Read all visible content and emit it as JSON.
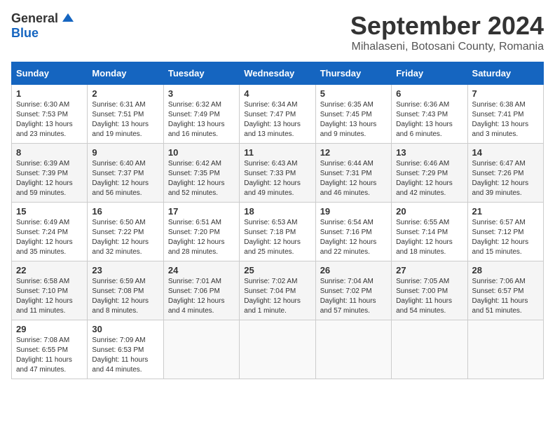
{
  "logo": {
    "general": "General",
    "blue": "Blue"
  },
  "header": {
    "month": "September 2024",
    "location": "Mihalaseni, Botosani County, Romania"
  },
  "days_of_week": [
    "Sunday",
    "Monday",
    "Tuesday",
    "Wednesday",
    "Thursday",
    "Friday",
    "Saturday"
  ],
  "weeks": [
    [
      {
        "day": "1",
        "sunrise": "6:30 AM",
        "sunset": "7:53 PM",
        "daylight": "13 hours and 23 minutes."
      },
      {
        "day": "2",
        "sunrise": "6:31 AM",
        "sunset": "7:51 PM",
        "daylight": "13 hours and 19 minutes."
      },
      {
        "day": "3",
        "sunrise": "6:32 AM",
        "sunset": "7:49 PM",
        "daylight": "13 hours and 16 minutes."
      },
      {
        "day": "4",
        "sunrise": "6:34 AM",
        "sunset": "7:47 PM",
        "daylight": "13 hours and 13 minutes."
      },
      {
        "day": "5",
        "sunrise": "6:35 AM",
        "sunset": "7:45 PM",
        "daylight": "13 hours and 9 minutes."
      },
      {
        "day": "6",
        "sunrise": "6:36 AM",
        "sunset": "7:43 PM",
        "daylight": "13 hours and 6 minutes."
      },
      {
        "day": "7",
        "sunrise": "6:38 AM",
        "sunset": "7:41 PM",
        "daylight": "13 hours and 3 minutes."
      }
    ],
    [
      {
        "day": "8",
        "sunrise": "6:39 AM",
        "sunset": "7:39 PM",
        "daylight": "12 hours and 59 minutes."
      },
      {
        "day": "9",
        "sunrise": "6:40 AM",
        "sunset": "7:37 PM",
        "daylight": "12 hours and 56 minutes."
      },
      {
        "day": "10",
        "sunrise": "6:42 AM",
        "sunset": "7:35 PM",
        "daylight": "12 hours and 52 minutes."
      },
      {
        "day": "11",
        "sunrise": "6:43 AM",
        "sunset": "7:33 PM",
        "daylight": "12 hours and 49 minutes."
      },
      {
        "day": "12",
        "sunrise": "6:44 AM",
        "sunset": "7:31 PM",
        "daylight": "12 hours and 46 minutes."
      },
      {
        "day": "13",
        "sunrise": "6:46 AM",
        "sunset": "7:29 PM",
        "daylight": "12 hours and 42 minutes."
      },
      {
        "day": "14",
        "sunrise": "6:47 AM",
        "sunset": "7:26 PM",
        "daylight": "12 hours and 39 minutes."
      }
    ],
    [
      {
        "day": "15",
        "sunrise": "6:49 AM",
        "sunset": "7:24 PM",
        "daylight": "12 hours and 35 minutes."
      },
      {
        "day": "16",
        "sunrise": "6:50 AM",
        "sunset": "7:22 PM",
        "daylight": "12 hours and 32 minutes."
      },
      {
        "day": "17",
        "sunrise": "6:51 AM",
        "sunset": "7:20 PM",
        "daylight": "12 hours and 28 minutes."
      },
      {
        "day": "18",
        "sunrise": "6:53 AM",
        "sunset": "7:18 PM",
        "daylight": "12 hours and 25 minutes."
      },
      {
        "day": "19",
        "sunrise": "6:54 AM",
        "sunset": "7:16 PM",
        "daylight": "12 hours and 22 minutes."
      },
      {
        "day": "20",
        "sunrise": "6:55 AM",
        "sunset": "7:14 PM",
        "daylight": "12 hours and 18 minutes."
      },
      {
        "day": "21",
        "sunrise": "6:57 AM",
        "sunset": "7:12 PM",
        "daylight": "12 hours and 15 minutes."
      }
    ],
    [
      {
        "day": "22",
        "sunrise": "6:58 AM",
        "sunset": "7:10 PM",
        "daylight": "12 hours and 11 minutes."
      },
      {
        "day": "23",
        "sunrise": "6:59 AM",
        "sunset": "7:08 PM",
        "daylight": "12 hours and 8 minutes."
      },
      {
        "day": "24",
        "sunrise": "7:01 AM",
        "sunset": "7:06 PM",
        "daylight": "12 hours and 4 minutes."
      },
      {
        "day": "25",
        "sunrise": "7:02 AM",
        "sunset": "7:04 PM",
        "daylight": "12 hours and 1 minute."
      },
      {
        "day": "26",
        "sunrise": "7:04 AM",
        "sunset": "7:02 PM",
        "daylight": "11 hours and 57 minutes."
      },
      {
        "day": "27",
        "sunrise": "7:05 AM",
        "sunset": "7:00 PM",
        "daylight": "11 hours and 54 minutes."
      },
      {
        "day": "28",
        "sunrise": "7:06 AM",
        "sunset": "6:57 PM",
        "daylight": "11 hours and 51 minutes."
      }
    ],
    [
      {
        "day": "29",
        "sunrise": "7:08 AM",
        "sunset": "6:55 PM",
        "daylight": "11 hours and 47 minutes."
      },
      {
        "day": "30",
        "sunrise": "7:09 AM",
        "sunset": "6:53 PM",
        "daylight": "11 hours and 44 minutes."
      },
      null,
      null,
      null,
      null,
      null
    ]
  ]
}
